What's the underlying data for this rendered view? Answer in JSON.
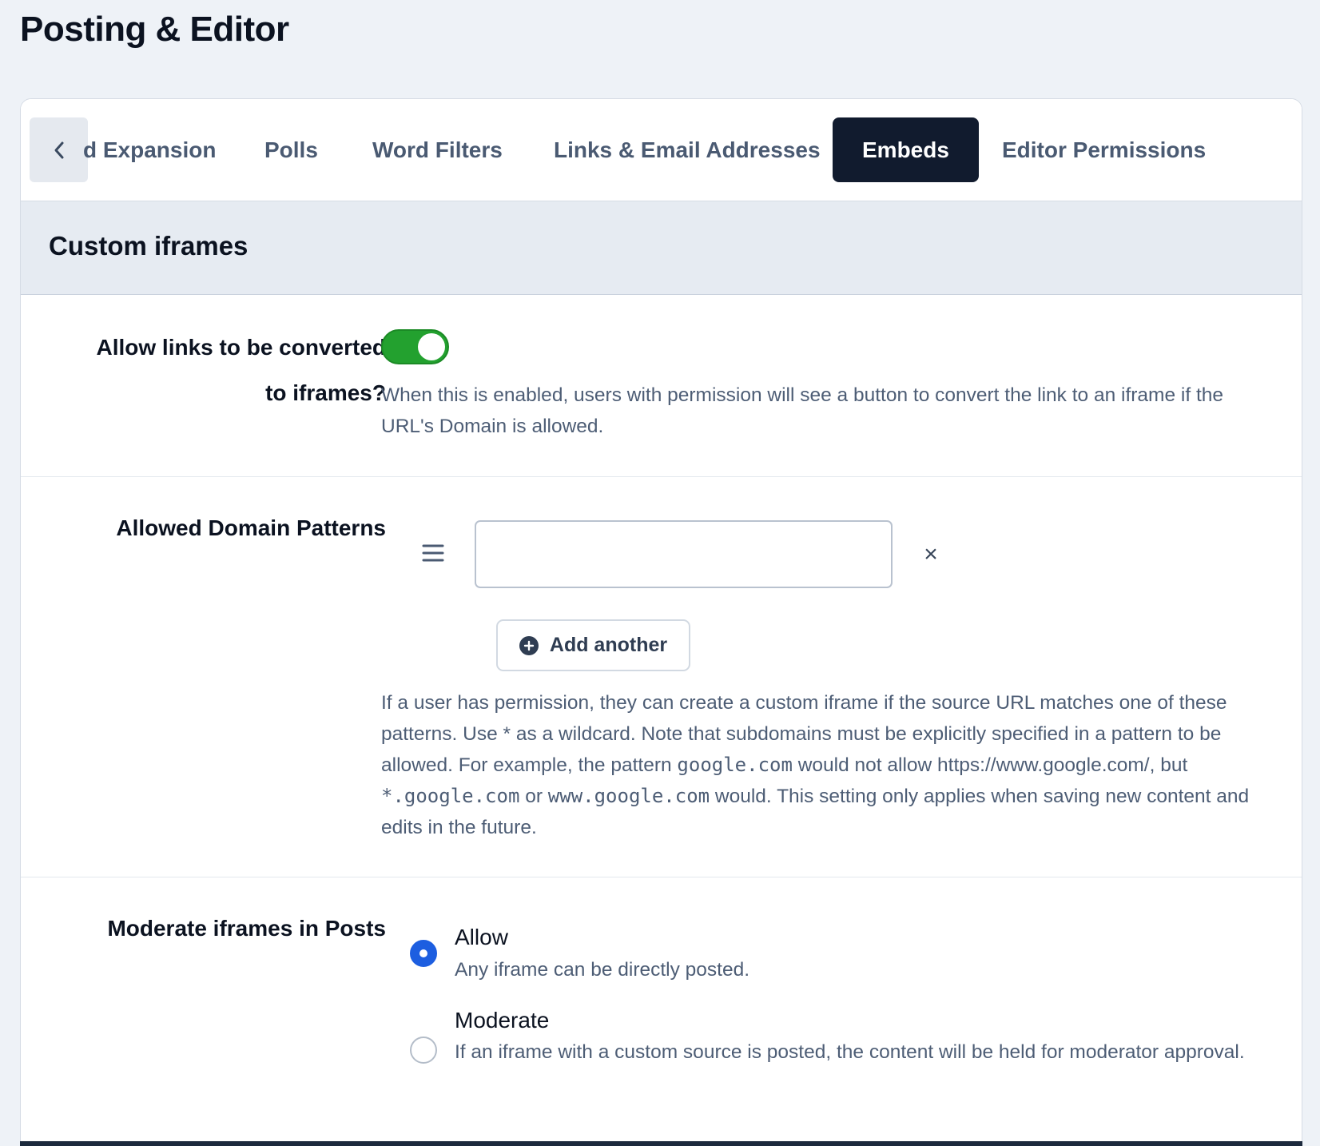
{
  "page": {
    "title": "Posting & Editor"
  },
  "tabs": [
    {
      "label": "d Expansion",
      "active": false
    },
    {
      "label": "Polls",
      "active": false
    },
    {
      "label": "Word Filters",
      "active": false
    },
    {
      "label": "Links & Email Addresses",
      "active": false
    },
    {
      "label": "Embeds",
      "active": true
    },
    {
      "label": "Editor Permissions",
      "active": false
    }
  ],
  "section": {
    "title": "Custom iframes"
  },
  "convert_links": {
    "label_line1": "Allow links to be converted",
    "label_line2": "to iframes?",
    "enabled": true,
    "help": "When this is enabled, users with permission will see a button to convert the link to an iframe if the URL's Domain is allowed."
  },
  "domain_patterns": {
    "label": "Allowed Domain Patterns",
    "input_value": "",
    "remove_label": "×",
    "add_label": "Add another",
    "help_1": "If a user has permission, they can create a custom iframe if the source URL matches one of these patterns. Use ",
    "help_wildcard": "*",
    "help_2": " as a wildcard. Note that subdomains must be explicitly specified in a pattern to be allowed. For example, the pattern ",
    "help_code_1": "google.com",
    "help_3": " would not allow https://www.google.com/, but ",
    "help_code_2": "*.google.com",
    "help_4": " or ",
    "help_code_3": "www.google.com",
    "help_5": " would. This setting only applies when saving new content and edits in the future."
  },
  "moderate": {
    "label": "Moderate iframes in Posts",
    "options": [
      {
        "title": "Allow",
        "desc": "Any iframe can be directly posted.",
        "checked": true
      },
      {
        "title": "Moderate",
        "desc": "If an iframe with a custom source is posted, the content will be held for moderator approval.",
        "checked": false
      }
    ]
  },
  "colors": {
    "accent": "#1d5ee0",
    "toggle_on": "#23a12f",
    "active_tab": "#111b2e"
  }
}
